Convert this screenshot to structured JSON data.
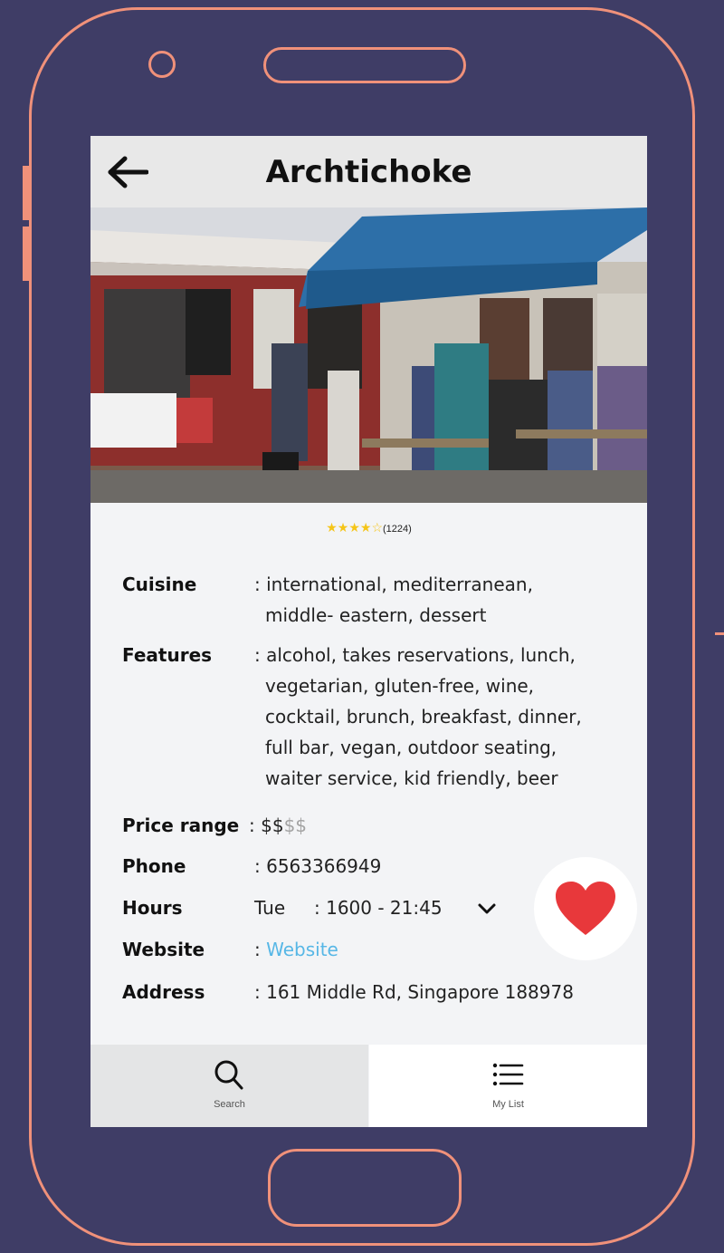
{
  "header": {
    "title": "Archtichoke"
  },
  "rating": {
    "stars_filled": 4,
    "stars_total": 5,
    "count": "(1224)"
  },
  "details": {
    "cuisine": {
      "label": "Cuisine",
      "lines": [
        ": international, mediterranean,",
        "middle- eastern, dessert"
      ]
    },
    "features": {
      "label": "Features",
      "lines": [
        ": alcohol, takes reservations, lunch,",
        "vegetarian, gluten-free, wine,",
        "cocktail, brunch, breakfast, dinner,",
        "full bar, vegan, outdoor seating,",
        "waiter service, kid friendly, beer"
      ]
    },
    "price": {
      "label": "Price range",
      "prefix": ": ",
      "active": "$$",
      "inactive": "$$"
    },
    "phone": {
      "label": "Phone",
      "value": ": 6563366949"
    },
    "hours": {
      "label": "Hours",
      "day": "Tue",
      "time": ": 1600 - 21:45"
    },
    "website": {
      "label": "Website",
      "prefix": ": ",
      "link": "Website"
    },
    "address": {
      "label": "Address",
      "value": ": 161 Middle Rd, Singapore 188978"
    }
  },
  "nav": {
    "search": {
      "label": "Search",
      "icon": "search-icon"
    },
    "mylist": {
      "label": "My List",
      "icon": "list-icon"
    }
  },
  "colors": {
    "background": "#3f3d66",
    "frame": "#f0917a",
    "star": "#f5c518",
    "heart": "#e8383b",
    "link": "#57b7e6"
  }
}
